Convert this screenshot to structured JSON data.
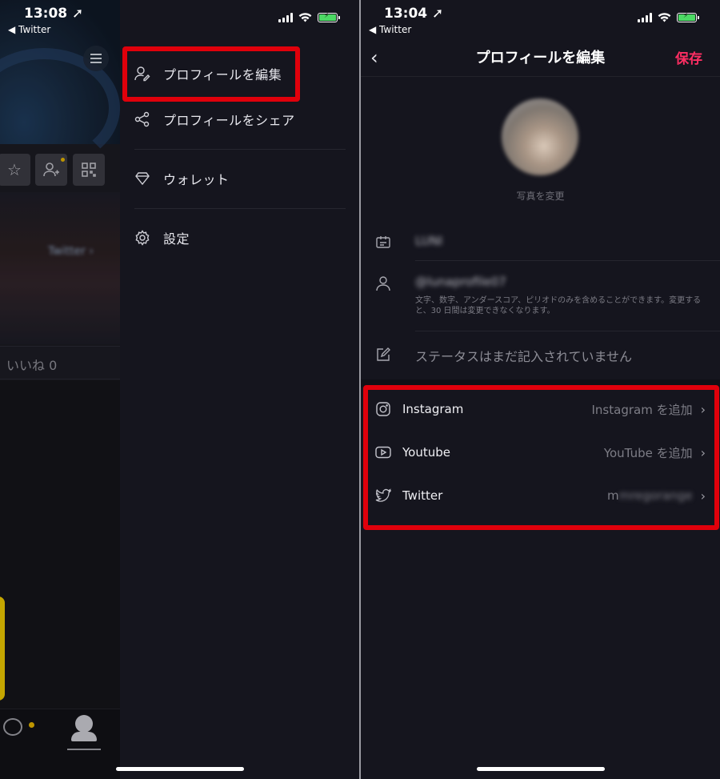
{
  "left": {
    "status": {
      "time": "13:08 ➚",
      "back_app": "◀ Twitter"
    },
    "background": {
      "likes_label": "いいね 0",
      "twitter_chip": "Twitter ›"
    },
    "drawer": {
      "items": [
        {
          "label": "プロフィールを編集",
          "icon": "edit-profile-icon"
        },
        {
          "label": "プロフィールをシェア",
          "icon": "share-icon"
        },
        {
          "label": "ウォレット",
          "icon": "diamond-icon"
        },
        {
          "label": "設定",
          "icon": "gear-icon"
        }
      ]
    }
  },
  "right": {
    "status": {
      "time": "13:04 ➚",
      "back_app": "◀ Twitter"
    },
    "nav": {
      "back": "‹",
      "title": "プロフィールを編集",
      "save": "保存"
    },
    "photo": {
      "change_label": "写真を変更"
    },
    "fields": {
      "nickname": "LUNI",
      "username": "@lunaprofile07",
      "username_hint": "文字、数字、アンダースコア、ピリオドのみを含めることができます。変更すると、30 日間は変更できなくなります。",
      "status_placeholder": "ステータスはまだ記入されていません"
    },
    "sns": [
      {
        "name": "Instagram",
        "value": "Instagram を追加",
        "icon": "instagram-icon"
      },
      {
        "name": "Youtube",
        "value": "YouTube を追加",
        "icon": "youtube-icon"
      },
      {
        "name": "Twitter",
        "value_prefix": "m",
        "value_blurred": "mregorange",
        "icon": "twitter-icon"
      }
    ]
  },
  "colors": {
    "accent": "#ff2e63",
    "highlight": "#e0000b",
    "background": "#15151e"
  }
}
